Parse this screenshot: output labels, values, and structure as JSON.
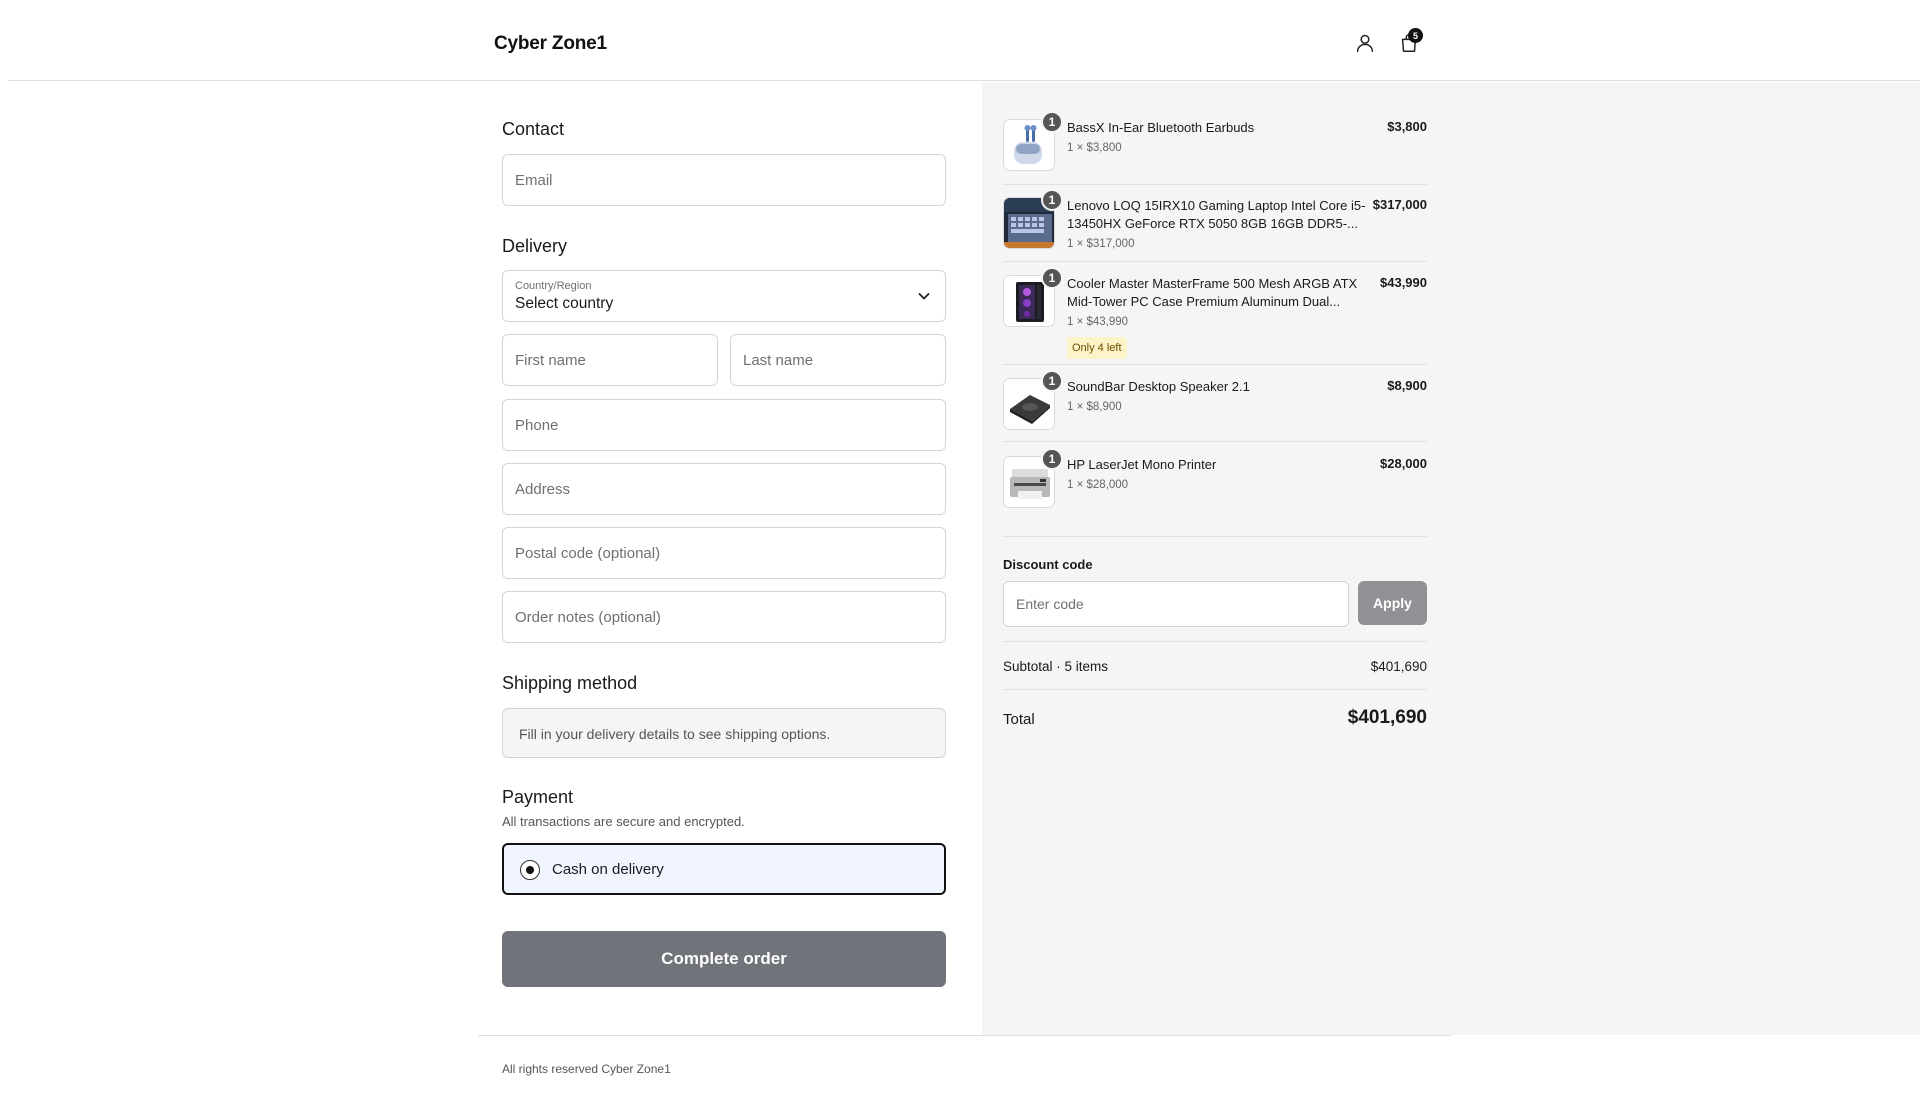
{
  "header": {
    "brand": "Cyber Zone1",
    "account_icon": "user-icon",
    "cart_icon": "shopping-bag-icon",
    "cart_count": "5"
  },
  "contact": {
    "title": "Contact",
    "email_placeholder": "Email"
  },
  "delivery": {
    "title": "Delivery",
    "country_label": "Country/Region",
    "country_value": "Select country",
    "first_name_placeholder": "First name",
    "last_name_placeholder": "Last name",
    "phone_placeholder": "Phone",
    "address_placeholder": "Address",
    "postal_placeholder": "Postal code (optional)",
    "notes_placeholder": "Order notes (optional)"
  },
  "shipping": {
    "title": "Shipping method",
    "message": "Fill in your delivery details to see shipping options."
  },
  "payment": {
    "title": "Payment",
    "subtitle": "All transactions are secure and encrypted.",
    "option_label": "Cash on delivery",
    "selected": true
  },
  "complete_button": "Complete order",
  "footer": "All rights reserved Cyber Zone1",
  "cart": {
    "items": [
      {
        "name": "BassX In-Ear Bluetooth Earbuds",
        "unit": "1 × $3,800",
        "price": "$3,800",
        "qty": "1",
        "badge": ""
      },
      {
        "name": "Lenovo LOQ 15IRX10 Gaming Laptop Intel Core i5-13450HX GeForce RTX 5050 8GB 16GB DDR5-...",
        "unit": "1 × $317,000",
        "price": "$317,000",
        "qty": "1",
        "badge": ""
      },
      {
        "name": "Cooler Master MasterFrame 500 Mesh ARGB ATX Mid-Tower PC Case Premium Aluminum Dual...",
        "unit": "1 × $43,990",
        "price": "$43,990",
        "qty": "1",
        "badge": "Only 4 left"
      },
      {
        "name": "SoundBar Desktop Speaker 2.1",
        "unit": "1 × $8,900",
        "price": "$8,900",
        "qty": "1",
        "badge": ""
      },
      {
        "name": "HP LaserJet Mono Printer",
        "unit": "1 × $28,000",
        "price": "$28,000",
        "qty": "1",
        "badge": ""
      }
    ]
  },
  "discount": {
    "label": "Discount code",
    "placeholder": "Enter code",
    "apply": "Apply"
  },
  "totals": {
    "subtotal_label": "Subtotal · 5 items",
    "subtotal_value": "$401,690",
    "total_label": "Total",
    "total_value": "$401,690"
  },
  "colors": {
    "accent": "#111111",
    "button_disabled": "#707379",
    "summary_bg": "#f5f5f5",
    "payment_selected_bg": "#f0f5ff",
    "stock_badge_bg": "#fdf3c8"
  }
}
